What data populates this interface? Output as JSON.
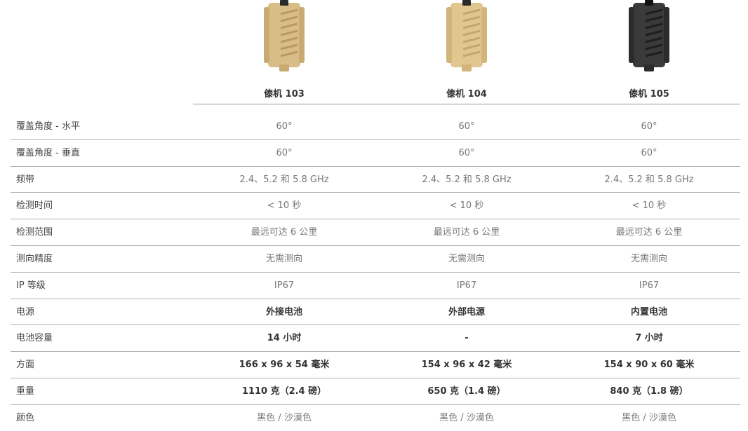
{
  "products": [
    {
      "name": "傣机 103",
      "color": "#d8bd86",
      "shade": "#b89b62"
    },
    {
      "name": "傣机 104",
      "color": "#e2c690",
      "shade": "#c4a76e"
    },
    {
      "name": "傣机 105",
      "color": "#3a3a3a",
      "shade": "#1e1e1e"
    }
  ],
  "specs": [
    {
      "label": "覆盖角度 - 水平",
      "values": [
        "60°",
        "60°",
        "60°"
      ],
      "bold": false
    },
    {
      "label": "覆盖角度 - 垂直",
      "values": [
        "60°",
        "60°",
        "60°"
      ],
      "bold": false
    },
    {
      "label": "频带",
      "values": [
        "2.4、5.2 和 5.8 GHz",
        "2.4、5.2 和 5.8 GHz",
        "2.4、5.2 和 5.8 GHz"
      ],
      "bold": false
    },
    {
      "label": "检测时间",
      "values": [
        "< 10 秒",
        "< 10 秒",
        "< 10 秒"
      ],
      "bold": false
    },
    {
      "label": "检测范围",
      "values": [
        "最远可达 6 公里",
        "最远可达 6 公里",
        "最远可达 6 公里"
      ],
      "bold": false
    },
    {
      "label": "测向精度",
      "values": [
        "无需测向",
        "无需测向",
        "无需测向"
      ],
      "bold": false
    },
    {
      "label": "IP 等级",
      "values": [
        "IP67",
        "IP67",
        "IP67"
      ],
      "bold": false
    },
    {
      "label": "电源",
      "values": [
        "外接电池",
        "外部电源",
        "内置电池"
      ],
      "bold": true
    },
    {
      "label": "电池容量",
      "values": [
        "14 小时",
        "-",
        "7 小时"
      ],
      "bold": true
    },
    {
      "label": "方面",
      "values": [
        "166 x 96 x 54 毫米",
        "154 x 96 x 42 毫米",
        "154 x 90 x 60 毫米"
      ],
      "bold": true
    },
    {
      "label": "重量",
      "values": [
        "1110 克（2.4 磅）",
        "650 克（1.4 磅）",
        "840 克（1.8 磅）"
      ],
      "bold": true
    },
    {
      "label": "颜色",
      "values": [
        "黑色 / 沙漠色",
        "黑色 / 沙漠色",
        "黑色 / 沙漠色"
      ],
      "bold": false
    }
  ]
}
